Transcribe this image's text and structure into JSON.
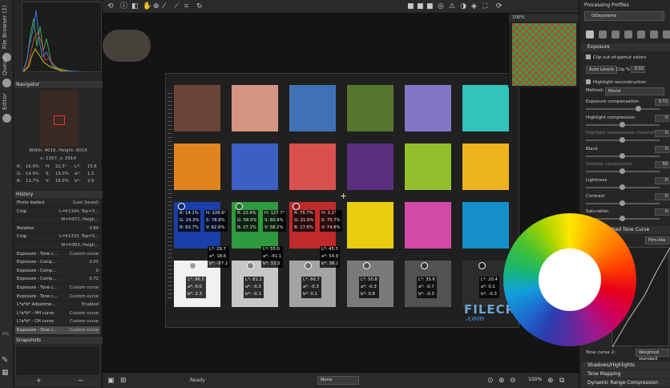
{
  "left_tabs": {
    "file_browser": "File Browser (2)",
    "queue": "Queue",
    "editor": "Editor"
  },
  "navigator": {
    "title": "Navigator",
    "size": "Width: 4016, Height: 6016",
    "coords": "x: 1357, y: 2914",
    "rgb": {
      "r_label": "R:",
      "r": "16.9%",
      "g_label": "G:",
      "g": "14.9%",
      "b_label": "B:",
      "b": "13.7%"
    },
    "hsv": {
      "h_label": "H:",
      "h": "22.5°",
      "s_label": "S:",
      "s": "19.0%",
      "v_label": "V:",
      "v": "16.9%"
    },
    "lab": {
      "l_label": "L*:",
      "l": "15.6",
      "a_label": "a*:",
      "a": "1.5",
      "b_label": "b*:",
      "b": "2.9"
    }
  },
  "history": {
    "title": "History",
    "rows": [
      {
        "name": "Photo loaded",
        "value": "(Last Saved)"
      },
      {
        "name": "Crop",
        "value": "L=fr1344, Top=3..."
      },
      {
        "name": "",
        "value": "W=fr972, Heigh..."
      },
      {
        "name": "Rotation",
        "value": "0.84"
      },
      {
        "name": "Crop",
        "value": "L=fr1333, Top=3..."
      },
      {
        "name": "",
        "value": "W=fr983, Heigh..."
      },
      {
        "name": "Exposure - Tone c...",
        "value": "Custom curve"
      },
      {
        "name": "Exposure - Comp...",
        "value": "0.03"
      },
      {
        "name": "Exposure - Comp...",
        "value": "0"
      },
      {
        "name": "Exposure - Comp...",
        "value": "0.72"
      },
      {
        "name": "Exposure - Tone c...",
        "value": "Custom curve"
      },
      {
        "name": "Exposure - Tone c...",
        "value": "Custom curve"
      },
      {
        "name": "L*a*b* Adjustme...",
        "value": "Enabled"
      },
      {
        "name": "L*a*b* - HH curve",
        "value": "Custom curve"
      },
      {
        "name": "L*a*b* - CH curve",
        "value": "Custom curve"
      },
      {
        "name": "Exposure - Tone c...",
        "value": "Custom curve"
      }
    ]
  },
  "snapshots": {
    "title": "Snapshots",
    "add": "+",
    "remove": "−"
  },
  "zoom_left": "0%",
  "canvas": {
    "crosshair": "+",
    "readouts": [
      {
        "rgb": "R: 14.1%\nG: 24.3%\nB: 62.7%",
        "hsv": "H: 226.6°\nS: 78.8%\nV: 62.6%",
        "lab": null
      },
      {
        "rgb": "R: 22.4%\nG: 58.0%\nB: 27.1%",
        "hsv": "H: 127.7°\nS: 60.9%\nV: 58.2%",
        "lab": "L*: 55.0\na*: -41.1\nb*: 33.3"
      },
      {
        "rgb": "R: 75.7%\nG: 21.6%\nB: 17.6%",
        "hsv": "H: 3.2°\nS: 75.7%\nV: 74.8%",
        "lab": "L*: 45.3\na*: 54.9\nb*: 38.2"
      }
    ],
    "lab_blue": "L*: 29.7\na*: 18.6\nb*: -57.2",
    "lab_greys": [
      "L*: 96.5\na*: 0.0\nb*: 2.3",
      "L*: 81.2\na*: -0.3\nb*: -0.1",
      "L*: 66.7\na*: -0.3\nb*: 0.1",
      "L*: 50.8\na*: -0.3\nb*: 0.8",
      "L*: 35.6\na*: -0.7\nb*: -0.3",
      "L*: 20.4\na*: 0.1\nb*: -0.3"
    ],
    "preview_zoom": "100%",
    "watermark": "FILECR",
    "watermark_sub": ".com"
  },
  "bottom": {
    "status": "Ready",
    "mode": "None",
    "zoom": "100%"
  },
  "right": {
    "title": "Processing Profiles",
    "profile": "ODsystems",
    "exposure_header": "Exposure",
    "clip_gamut": "Clip out-of-gamut colors",
    "auto_levels": "Auto Levels",
    "clip_label": "Clip %:",
    "clip_value": "0.02",
    "highlight_recon": "Highlight reconstruction",
    "method_label": "Method:",
    "method_value": "Blend",
    "sliders": [
      {
        "label": "Exposure compensation",
        "value": "0.72",
        "muted": false
      },
      {
        "label": "Highlight compression",
        "value": "0",
        "muted": false
      },
      {
        "label": "Highlight compression threshold",
        "value": "0",
        "muted": true
      },
      {
        "label": "Black",
        "value": "0",
        "muted": false
      },
      {
        "label": "Shadow compression",
        "value": "50",
        "muted": true
      },
      {
        "label": "Lightness",
        "value": "0",
        "muted": false
      },
      {
        "label": "Contrast",
        "value": "0",
        "muted": false
      },
      {
        "label": "Saturation",
        "value": "0",
        "muted": false
      }
    ],
    "tone_curve_1": "Auto-Matched Tone Curve",
    "film_like": "Film-like",
    "tone_curve_2_label": "Tone curve 2:",
    "weighted": "Weighted standard",
    "panels": [
      "Shadows/Highlights",
      "Tone Mapping",
      "Dynamic Range Compression"
    ]
  },
  "colors": {
    "patches": [
      [
        "#6a4436",
        "#d49581",
        "#3f72b5",
        "#56762f",
        "#8177c6",
        "#32c3bd"
      ],
      [
        "#e0841d",
        "#3d5ec2",
        "#d9514e",
        "#5c2e7e",
        "#94bf2c",
        "#eeb41f"
      ],
      [
        "#1a3fa8",
        "#2f9a3e",
        "#c12a2a",
        "#e9cd10",
        "#d44aa7",
        "#1690c9"
      ],
      [
        "#f1f1f1",
        "#c7c7c7",
        "#a3a3a3",
        "#7a7a7a",
        "#525252",
        "#2c2c2c"
      ]
    ]
  }
}
